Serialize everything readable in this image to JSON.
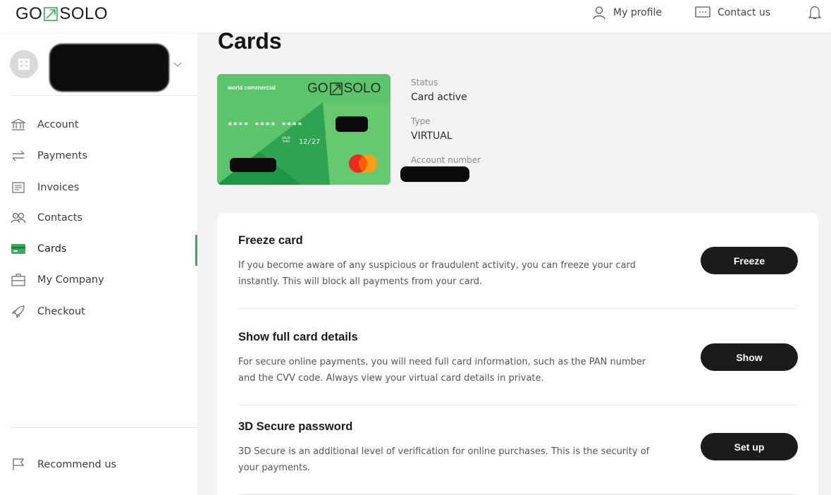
{
  "header": {
    "logo_left": "GO",
    "logo_right": "SOLO",
    "my_profile": "My profile",
    "contact_us": "Contact us"
  },
  "sidebar": {
    "items": [
      {
        "label": "Account",
        "icon": "bank-icon"
      },
      {
        "label": "Payments",
        "icon": "transfer-arrows-icon"
      },
      {
        "label": "Invoices",
        "icon": "invoice-icon"
      },
      {
        "label": "Contacts",
        "icon": "people-icon"
      },
      {
        "label": "Cards",
        "icon": "card-icon",
        "active": true
      },
      {
        "label": "My Company",
        "icon": "briefcase-icon"
      },
      {
        "label": "Checkout",
        "icon": "rocket-icon"
      }
    ],
    "recommend": "Recommend us"
  },
  "main": {
    "title": "Cards",
    "card": {
      "brand_text": "world commercial",
      "logo_left": "GO",
      "logo_right": "SOLO",
      "masked_number": "**** **** ****",
      "valid_thru": "VALID\nTHRU",
      "expiry": "12/27"
    },
    "info": {
      "status_label": "Status",
      "status_value": "Card active",
      "type_label": "Type",
      "type_value": "VIRTUAL",
      "account_label": "Account number"
    },
    "actions": [
      {
        "title": "Freeze card",
        "description": "If you become aware of any suspicious or fraudulent activity, you can freeze your card instantly. This will block all payments from your card.",
        "button": "Freeze"
      },
      {
        "title": "Show full card details",
        "description": "For secure online payments, you will need full card information, such as the PAN number and the CVV code. Always view your virtual card details in private.",
        "button": "Show"
      },
      {
        "title": "3D Secure password",
        "description": "3D Secure is an additional level of verification for online purchases. This is the security of your payments.",
        "button": "Set up"
      }
    ]
  },
  "colors": {
    "accent_green": "#3aaa5c",
    "card_green": "#5cc46a",
    "button_dark": "#1c1c1c"
  }
}
